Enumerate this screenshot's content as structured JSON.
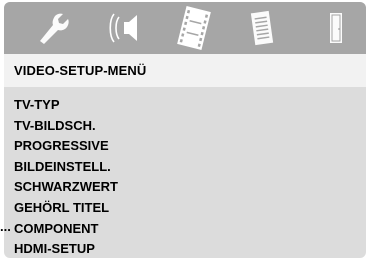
{
  "tabs": [
    {
      "icon": "wrench-icon",
      "selected": false
    },
    {
      "icon": "speaker-sound-icon",
      "selected": false
    },
    {
      "icon": "film-strip-icon",
      "selected": true
    },
    {
      "icon": "document-list-icon",
      "selected": false
    },
    {
      "icon": "door-exit-icon",
      "selected": false
    }
  ],
  "menu_title": "VIDEO-SETUP-MENÜ",
  "menu_items": [
    {
      "label": "TV-TYP"
    },
    {
      "label": "TV-BILDSCH."
    },
    {
      "label": "PROGRESSIVE"
    },
    {
      "label": "BILDEINSTELL."
    },
    {
      "label": "SCHWARZWERT"
    },
    {
      "label": "GEHÖRL TITEL"
    },
    {
      "label": "COMPONENT"
    },
    {
      "label": "HDMI-SETUP"
    }
  ],
  "pointer_text": "...",
  "colors": {
    "tab_bar": "#a6a6a6",
    "panel": "#dcdcdc",
    "title_band": "#f2f2f2",
    "text": "#000000",
    "icon_idle": "#ffffff",
    "icon_selected": "#ffffff"
  }
}
